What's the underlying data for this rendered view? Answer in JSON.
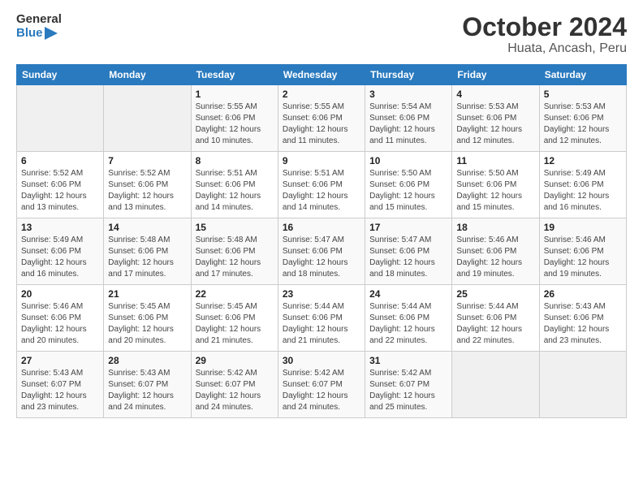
{
  "logo": {
    "line1": "General",
    "line2": "Blue"
  },
  "title": "October 2024",
  "subtitle": "Huata, Ancash, Peru",
  "weekdays": [
    "Sunday",
    "Monday",
    "Tuesday",
    "Wednesday",
    "Thursday",
    "Friday",
    "Saturday"
  ],
  "weeks": [
    [
      {
        "day": "",
        "info": ""
      },
      {
        "day": "",
        "info": ""
      },
      {
        "day": "1",
        "info": "Sunrise: 5:55 AM\nSunset: 6:06 PM\nDaylight: 12 hours and 10 minutes."
      },
      {
        "day": "2",
        "info": "Sunrise: 5:55 AM\nSunset: 6:06 PM\nDaylight: 12 hours and 11 minutes."
      },
      {
        "day": "3",
        "info": "Sunrise: 5:54 AM\nSunset: 6:06 PM\nDaylight: 12 hours and 11 minutes."
      },
      {
        "day": "4",
        "info": "Sunrise: 5:53 AM\nSunset: 6:06 PM\nDaylight: 12 hours and 12 minutes."
      },
      {
        "day": "5",
        "info": "Sunrise: 5:53 AM\nSunset: 6:06 PM\nDaylight: 12 hours and 12 minutes."
      }
    ],
    [
      {
        "day": "6",
        "info": "Sunrise: 5:52 AM\nSunset: 6:06 PM\nDaylight: 12 hours and 13 minutes."
      },
      {
        "day": "7",
        "info": "Sunrise: 5:52 AM\nSunset: 6:06 PM\nDaylight: 12 hours and 13 minutes."
      },
      {
        "day": "8",
        "info": "Sunrise: 5:51 AM\nSunset: 6:06 PM\nDaylight: 12 hours and 14 minutes."
      },
      {
        "day": "9",
        "info": "Sunrise: 5:51 AM\nSunset: 6:06 PM\nDaylight: 12 hours and 14 minutes."
      },
      {
        "day": "10",
        "info": "Sunrise: 5:50 AM\nSunset: 6:06 PM\nDaylight: 12 hours and 15 minutes."
      },
      {
        "day": "11",
        "info": "Sunrise: 5:50 AM\nSunset: 6:06 PM\nDaylight: 12 hours and 15 minutes."
      },
      {
        "day": "12",
        "info": "Sunrise: 5:49 AM\nSunset: 6:06 PM\nDaylight: 12 hours and 16 minutes."
      }
    ],
    [
      {
        "day": "13",
        "info": "Sunrise: 5:49 AM\nSunset: 6:06 PM\nDaylight: 12 hours and 16 minutes."
      },
      {
        "day": "14",
        "info": "Sunrise: 5:48 AM\nSunset: 6:06 PM\nDaylight: 12 hours and 17 minutes."
      },
      {
        "day": "15",
        "info": "Sunrise: 5:48 AM\nSunset: 6:06 PM\nDaylight: 12 hours and 17 minutes."
      },
      {
        "day": "16",
        "info": "Sunrise: 5:47 AM\nSunset: 6:06 PM\nDaylight: 12 hours and 18 minutes."
      },
      {
        "day": "17",
        "info": "Sunrise: 5:47 AM\nSunset: 6:06 PM\nDaylight: 12 hours and 18 minutes."
      },
      {
        "day": "18",
        "info": "Sunrise: 5:46 AM\nSunset: 6:06 PM\nDaylight: 12 hours and 19 minutes."
      },
      {
        "day": "19",
        "info": "Sunrise: 5:46 AM\nSunset: 6:06 PM\nDaylight: 12 hours and 19 minutes."
      }
    ],
    [
      {
        "day": "20",
        "info": "Sunrise: 5:46 AM\nSunset: 6:06 PM\nDaylight: 12 hours and 20 minutes."
      },
      {
        "day": "21",
        "info": "Sunrise: 5:45 AM\nSunset: 6:06 PM\nDaylight: 12 hours and 20 minutes."
      },
      {
        "day": "22",
        "info": "Sunrise: 5:45 AM\nSunset: 6:06 PM\nDaylight: 12 hours and 21 minutes."
      },
      {
        "day": "23",
        "info": "Sunrise: 5:44 AM\nSunset: 6:06 PM\nDaylight: 12 hours and 21 minutes."
      },
      {
        "day": "24",
        "info": "Sunrise: 5:44 AM\nSunset: 6:06 PM\nDaylight: 12 hours and 22 minutes."
      },
      {
        "day": "25",
        "info": "Sunrise: 5:44 AM\nSunset: 6:06 PM\nDaylight: 12 hours and 22 minutes."
      },
      {
        "day": "26",
        "info": "Sunrise: 5:43 AM\nSunset: 6:06 PM\nDaylight: 12 hours and 23 minutes."
      }
    ],
    [
      {
        "day": "27",
        "info": "Sunrise: 5:43 AM\nSunset: 6:07 PM\nDaylight: 12 hours and 23 minutes."
      },
      {
        "day": "28",
        "info": "Sunrise: 5:43 AM\nSunset: 6:07 PM\nDaylight: 12 hours and 24 minutes."
      },
      {
        "day": "29",
        "info": "Sunrise: 5:42 AM\nSunset: 6:07 PM\nDaylight: 12 hours and 24 minutes."
      },
      {
        "day": "30",
        "info": "Sunrise: 5:42 AM\nSunset: 6:07 PM\nDaylight: 12 hours and 24 minutes."
      },
      {
        "day": "31",
        "info": "Sunrise: 5:42 AM\nSunset: 6:07 PM\nDaylight: 12 hours and 25 minutes."
      },
      {
        "day": "",
        "info": ""
      },
      {
        "day": "",
        "info": ""
      }
    ]
  ]
}
